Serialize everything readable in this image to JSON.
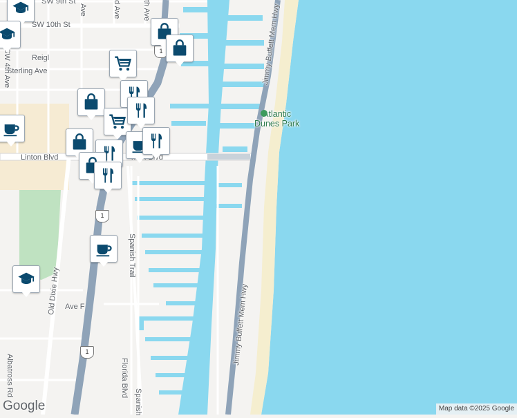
{
  "map": {
    "colors": {
      "water": "#8ad8ef",
      "land": "#f4f3f1",
      "road": "#ffffff",
      "highway": "#8fa3b8",
      "park": "#bfe2c1",
      "campus": "#f6ebd3",
      "marker_blue": "#0b4a6e"
    },
    "streets": {
      "sw_9th_st": "SW 9th St",
      "sw_10th_st": "SW 10th St",
      "reigle": "Reigl",
      "sterling_ave": "Sterling Ave",
      "sw_4th_ave": "SW 4th Ave",
      "linton_blvd": "Linton Blvd",
      "linton_blvd_partial": "nton Blvd",
      "spanish_trail": "Spanish Trail",
      "spanish_partial": "Spanish",
      "old_dixie_hwy": "Old Dixie Hwy",
      "ave_f": "Ave F",
      "florida_blvd": "Florida Blvd",
      "albatross_rd": "Albatross Rd",
      "jimmy_buffett_1": "Jimmy Buffett Mem Hwy",
      "jimmy_buffett_2": "Jimmy Buffett Mem Hwy",
      "ave_a": "Ave",
      "ave_b": "d Ave",
      "ave_c": "th Ave",
      "us1": "1"
    },
    "places": {
      "park": "Atlantic\nDunes Park"
    },
    "markers": [
      {
        "icon": "school-icon"
      },
      {
        "icon": "school-icon"
      },
      {
        "icon": "shopping-bag-icon"
      },
      {
        "icon": "shopping-bag-icon"
      },
      {
        "icon": "shopping-cart-icon"
      },
      {
        "icon": "restaurant-icon"
      },
      {
        "icon": "shopping-bag-icon"
      },
      {
        "icon": "coffee-icon"
      },
      {
        "icon": "shopping-cart-icon"
      },
      {
        "icon": "restaurant-icon"
      },
      {
        "icon": "shopping-bag-icon"
      },
      {
        "icon": "coffee-icon"
      },
      {
        "icon": "restaurant-icon"
      },
      {
        "icon": "shopping-bag-icon"
      },
      {
        "icon": "restaurant-icon"
      },
      {
        "icon": "restaurant-icon"
      },
      {
        "icon": "coffee-icon"
      },
      {
        "icon": "school-icon"
      }
    ],
    "attribution": {
      "logo": "Google",
      "credit": "Map data ©2025 Google"
    }
  }
}
